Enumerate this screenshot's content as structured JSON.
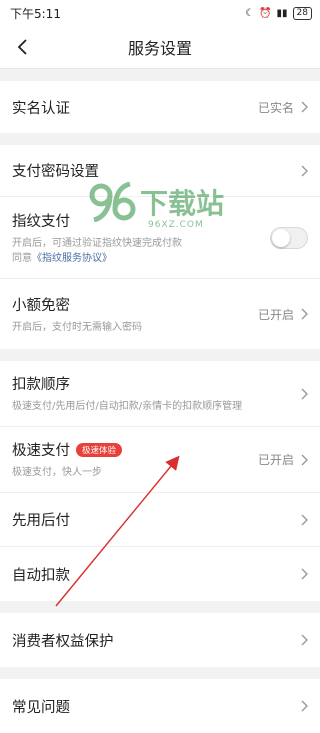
{
  "status": {
    "time": "下午5:11",
    "battery": "28"
  },
  "nav": {
    "title": "服务设置"
  },
  "rows": {
    "realname": {
      "label": "实名认证",
      "value": "已实名"
    },
    "paypwd": {
      "label": "支付密码设置"
    },
    "fingerprint": {
      "label": "指纹支付",
      "desc": "开启后，可通过验证指纹快速完成付款",
      "agree_prefix": "同意",
      "agree_link": "《指纹服务协议》",
      "enabled": false
    },
    "smallfree": {
      "label": "小额免密",
      "desc": "开启后，支付时无需输入密码",
      "value": "已开启"
    },
    "order": {
      "label": "扣款顺序",
      "desc": "极速支付/先用后付/自动扣款/亲情卡的扣款顺序管理"
    },
    "fastpay": {
      "label": "极速支付",
      "tag": "极速体验",
      "desc": "极速支付，快人一步",
      "value": "已开启"
    },
    "payafter": {
      "label": "先用后付"
    },
    "autodeduct": {
      "label": "自动扣款"
    },
    "consumer": {
      "label": "消费者权益保护"
    },
    "faq": {
      "label": "常见问题"
    }
  },
  "watermark": {
    "text": "下载站",
    "sub": "96XZ.COM"
  },
  "colors": {
    "tag_bg": "#e8413c",
    "arrow": "#d9302f",
    "link": "#4a6fa5"
  }
}
